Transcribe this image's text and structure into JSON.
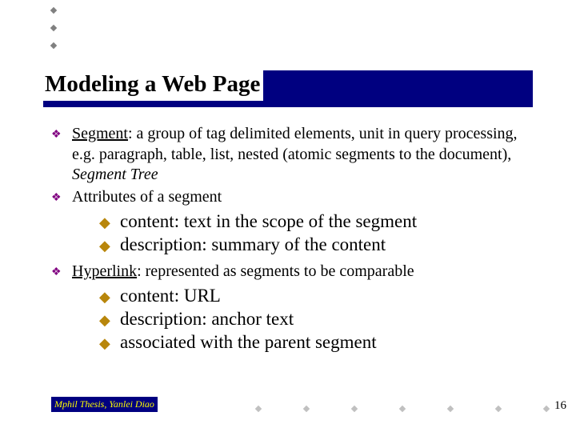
{
  "title": "Modeling a Web Page",
  "bullets": [
    {
      "lead": "Segment",
      "rest": ": a group of tag delimited elements, unit in query processing, e.g. paragraph, table, list, nested (atomic segments to the document), ",
      "tail_italic": "Segment Tree"
    },
    {
      "lead": "",
      "rest": "Attributes of a segment",
      "tail_italic": ""
    },
    {
      "lead": "Hyperlink",
      "rest": ": represented as segments to be comparable",
      "tail_italic": ""
    }
  ],
  "sub1": [
    "content: text in the scope of the segment",
    "description: summary of the content"
  ],
  "sub2": [
    "content: URL",
    "description: anchor text",
    "associated with the parent segment"
  ],
  "footer": "Mphil Thesis, Yanlei Diao",
  "page": "16",
  "icons": {
    "main": "❖",
    "sub": "◆"
  }
}
